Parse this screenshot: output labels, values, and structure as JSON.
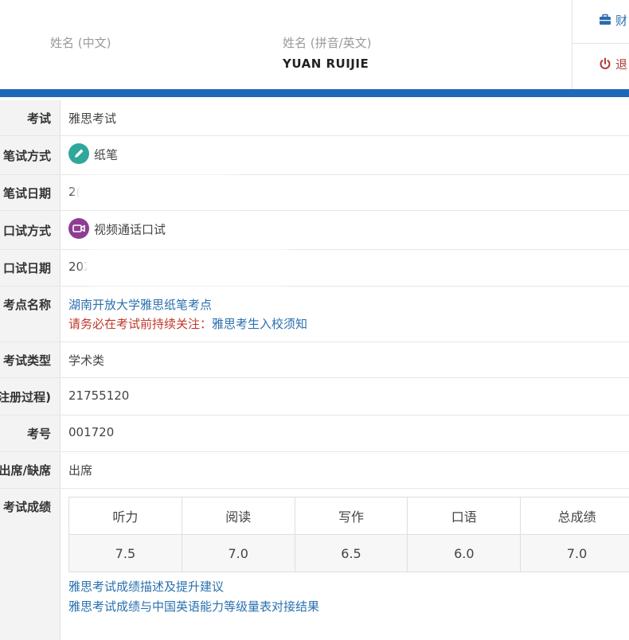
{
  "header": {
    "name_cn_label": "姓名 (中文)",
    "name_cn_value": "",
    "name_en_label": "姓名 (拼音/英文)",
    "name_en_value": "YUAN  RUIJIE",
    "menu": [
      {
        "label": "财",
        "icon": "briefcase-icon"
      },
      {
        "label": "退",
        "icon": "power-icon"
      }
    ]
  },
  "colors": {
    "accent_bar": "#1f67b9",
    "link": "#2a70ae",
    "warning": "#c0392b",
    "paper_icon": "#2fa79a",
    "video_icon": "#8e3d93"
  },
  "rows": {
    "exam": {
      "label": "考试",
      "value": "雅思考试"
    },
    "written_mode": {
      "label": "笔试方式",
      "value": "纸笔",
      "icon": "pencil-icon"
    },
    "written_date": {
      "label": "笔试日期",
      "value": "2("
    },
    "speaking_mode": {
      "label": "口试方式",
      "value": "视频通话口试",
      "icon": "video-camera-icon"
    },
    "speaking_date": {
      "label": "口试日期",
      "value": "202"
    },
    "test_center": {
      "label": "考点名称",
      "value": "湖南开放大学雅思纸笔考点",
      "notice_prefix": "请务必在考试前持续关注：",
      "notice_link": "雅思考生入校须知"
    },
    "exam_type": {
      "label": "考试类型",
      "value": "学术类"
    },
    "registration": {
      "label": "注册过程)",
      "value": "21755120"
    },
    "candidate_no": {
      "label": "考号",
      "value": "001720"
    },
    "attendance": {
      "label": "出席/缺席",
      "value": "出席"
    },
    "scores": {
      "label": "考试成绩",
      "headers": [
        "听力",
        "阅读",
        "写作",
        "口语",
        "总成绩"
      ],
      "values": [
        "7.5",
        "7.0",
        "6.5",
        "6.0",
        "7.0"
      ]
    }
  },
  "links": {
    "score_desc": "雅思考试成绩描述及提升建议",
    "score_mapping": "雅思考试成绩与中国英语能力等级量表对接结果"
  }
}
